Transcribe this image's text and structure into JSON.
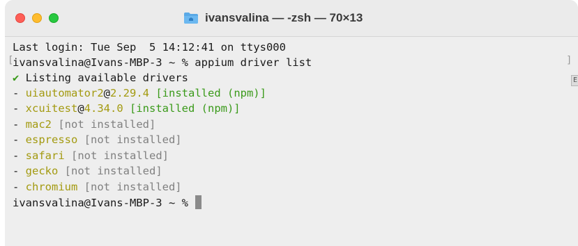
{
  "window": {
    "title": "ivansvalina — -zsh — 70×13",
    "title_icon": "folder-icon"
  },
  "terminal": {
    "last_login": "Last login: Tue Sep  5 14:12:41 on ttys000",
    "prompt": "ivansvalina@Ivans-MBP-3 ~ % ",
    "command": "appium driver list",
    "listing_check": "✔",
    "listing_text": " Listing available drivers",
    "drivers": [
      {
        "dash": "- ",
        "name": "uiautomator2",
        "at": "@",
        "version": "2.29.4",
        "status": " [installed (npm)]"
      },
      {
        "dash": "- ",
        "name": "xcuitest",
        "at": "@",
        "version": "4.34.0",
        "status": " [installed (npm)]"
      },
      {
        "dash": "- ",
        "name": "mac2",
        "status": " [not installed]"
      },
      {
        "dash": "- ",
        "name": "espresso",
        "status": " [not installed]"
      },
      {
        "dash": "- ",
        "name": "safari",
        "status": " [not installed]"
      },
      {
        "dash": "- ",
        "name": "gecko",
        "status": " [not installed]"
      },
      {
        "dash": "- ",
        "name": "chromium",
        "status": " [not installed]"
      }
    ],
    "final_prompt": "ivansvalina@Ivans-MBP-3 ~ % "
  },
  "colors": {
    "installed": "#3a9a1a",
    "driver_name": "#a39a10",
    "not_installed": "#808080"
  }
}
